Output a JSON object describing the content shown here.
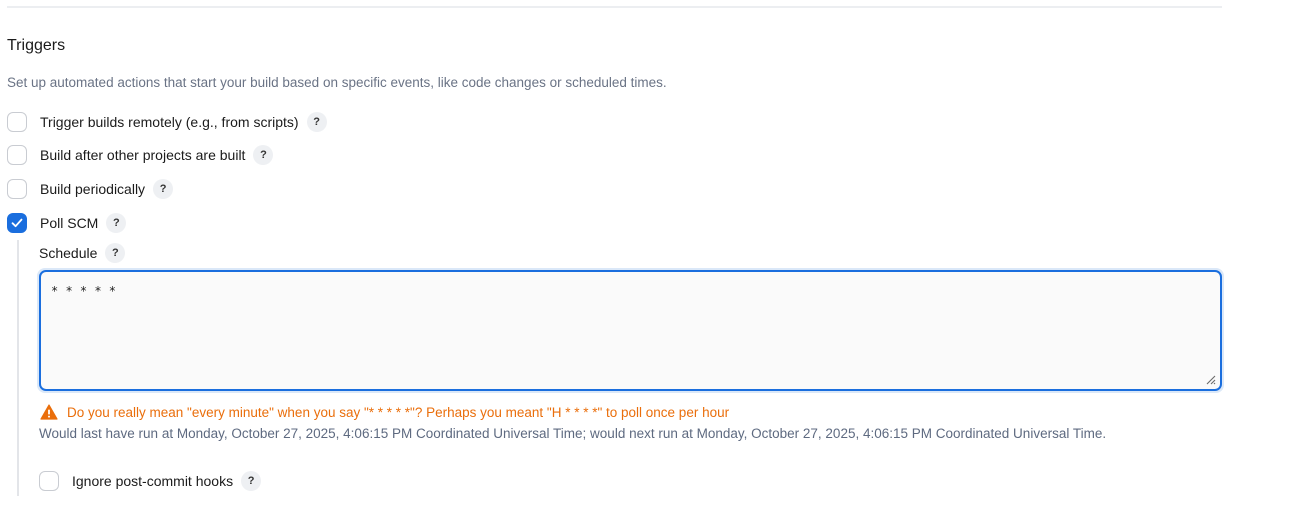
{
  "section": {
    "title": "Triggers",
    "description": "Set up automated actions that start your build based on specific events, like code changes or scheduled times."
  },
  "triggers": [
    {
      "label": "Trigger builds remotely (e.g., from scripts)",
      "checked": false,
      "help": "?"
    },
    {
      "label": "Build after other projects are built",
      "checked": false,
      "help": "?"
    },
    {
      "label": "Build periodically",
      "checked": false,
      "help": "?"
    },
    {
      "label": "Poll SCM",
      "checked": true,
      "help": "?"
    }
  ],
  "poll_scm": {
    "schedule_label": "Schedule",
    "schedule_help": "?",
    "schedule_value": "* * * * *",
    "warning": "Do you really mean \"every minute\" when you say \"* * * * *\"? Perhaps you meant \"H * * * *\" to poll once per hour",
    "info": "Would last have run at Monday, October 27, 2025, 4:06:15 PM Coordinated Universal Time; would next run at Monday, October 27, 2025, 4:06:15 PM Coordinated Universal Time.",
    "ignore_hooks_label": "Ignore post-commit hooks",
    "ignore_hooks_checked": false,
    "ignore_hooks_help": "?"
  },
  "colors": {
    "accent": "#1a6ede",
    "warning": "#ea6e0b",
    "muted_text": "#6a7385"
  },
  "icons": {
    "check": "checkmark-icon",
    "warning": "warning-triangle-icon",
    "help": "question-mark-icon",
    "resize": "resize-grip-icon"
  }
}
